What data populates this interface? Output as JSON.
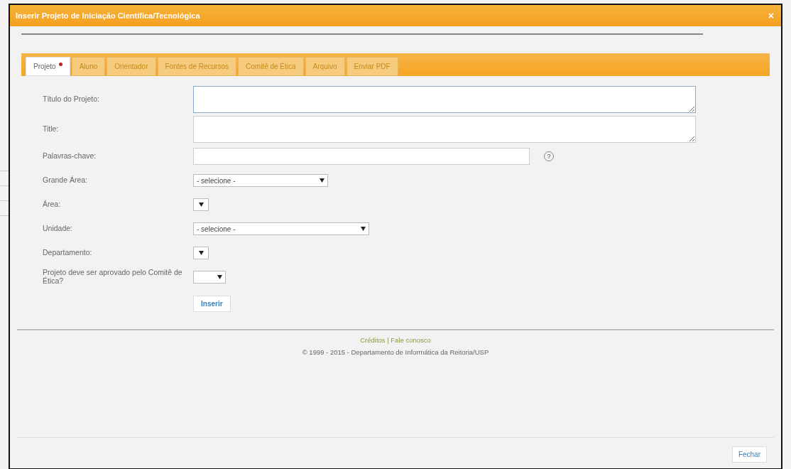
{
  "dialog": {
    "title": "Inserir Projeto de Iniciação Científica/Tecnológica",
    "close": "×"
  },
  "tabs": [
    {
      "label": "Projeto",
      "selected": true,
      "required": true
    },
    {
      "label": "Aluno",
      "selected": false,
      "required": false
    },
    {
      "label": "Orientador",
      "selected": false,
      "required": false
    },
    {
      "label": "Fontes de Recursos",
      "selected": false,
      "required": false
    },
    {
      "label": "Comitê de Ética",
      "selected": false,
      "required": false
    },
    {
      "label": "Arquivo",
      "selected": false,
      "required": false
    },
    {
      "label": "Enviar PDF",
      "selected": false,
      "required": false
    }
  ],
  "form": [
    {
      "label": "Título do Projeto:",
      "kind": "textarea",
      "focused": true
    },
    {
      "label": "Title:",
      "kind": "textarea",
      "focused": false
    },
    {
      "label": "Palavras-chave:",
      "kind": "text",
      "help": "?"
    },
    {
      "label": "Grande Área:",
      "kind": "select",
      "value": "- selecione -"
    },
    {
      "label": "Área:",
      "kind": "select"
    },
    {
      "label": "Unidade:",
      "kind": "select",
      "value": "- selecione -"
    },
    {
      "label": "Departamento:",
      "kind": "select"
    },
    {
      "label": "Projeto deve ser aprovado pelo Comitê de Ética?",
      "kind": "select"
    }
  ],
  "submit": "Inserir",
  "footer": {
    "links": "Créditos | Fale conosco",
    "copyright": "© 1999 - 2015 - Departamento de Informática da Reitoria/USP"
  },
  "close_button": "Fechar"
}
